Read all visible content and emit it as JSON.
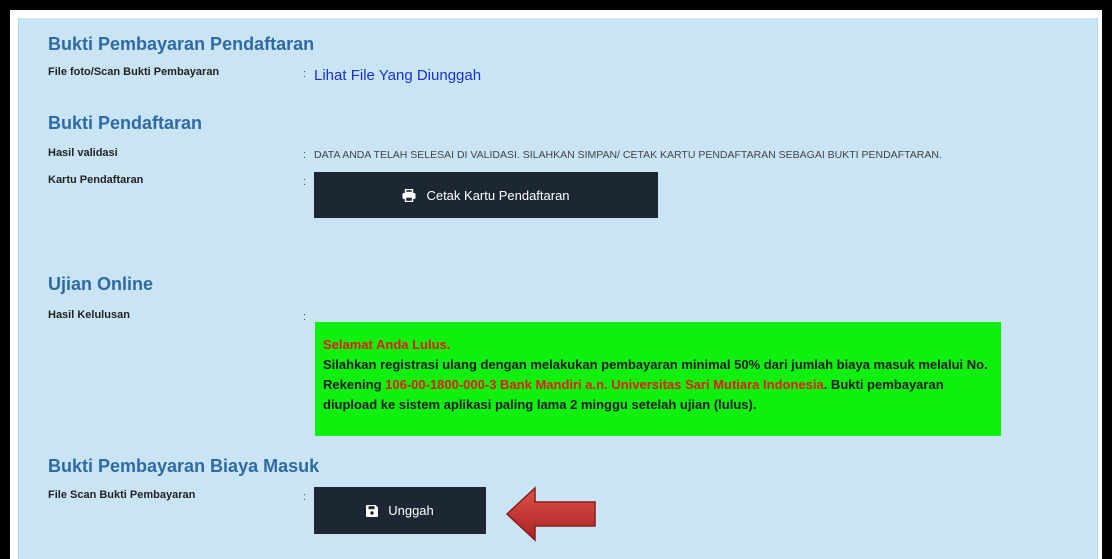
{
  "sections": {
    "pembayaran_pendaftaran": {
      "title": "Bukti Pembayaran Pendaftaran",
      "file_label": "File foto/Scan Bukti Pembayaran",
      "file_link": "Lihat File Yang Diunggah"
    },
    "bukti_pendaftaran": {
      "title": "Bukti Pendaftaran",
      "validasi_label": "Hasil validasi",
      "validasi_value": "DATA ANDA TELAH SELESAI DI VALIDASI. SILAHKAN SIMPAN/ CETAK KARTU PENDAFTARAN SEBAGAI BUKTI PENDAFTARAN.",
      "kartu_label": "Kartu Pendaftaran",
      "print_button": "Cetak Kartu Pendaftaran"
    },
    "ujian_online": {
      "title": "Ujian Online",
      "hasil_label": "Hasil Kelulusan",
      "notice": {
        "congrats": "Selamat Anda Lulus.",
        "text_1": "Silahkan registrasi ulang dengan melakukan pembayaran minimal 50% dari jumlah biaya masuk melalui No. Rekening ",
        "account": "106-00-1800-000-3 Bank Mandiri a.n. Universitas Sari Mutiara Indonesia",
        "text_2": ". Bukti pembayaran diupload ke sistem aplikasi paling lama 2 minggu setelah ujian (lulus)."
      }
    },
    "biaya_masuk": {
      "title": "Bukti Pembayaran Biaya Masuk",
      "file_label": "File Scan Bukti Pembayaran",
      "upload_button": "Unggah"
    }
  },
  "separator": ":",
  "icons": {
    "print": "printer-icon",
    "upload": "save-icon",
    "pointer": "arrow-left-icon"
  },
  "colors": {
    "panel": "#c9e5f5",
    "heading": "#2f6aa3",
    "button": "#1d2733",
    "notice_bg": "#0ff00f",
    "alert_red": "#e51b1b",
    "link": "#1a2fd0"
  }
}
